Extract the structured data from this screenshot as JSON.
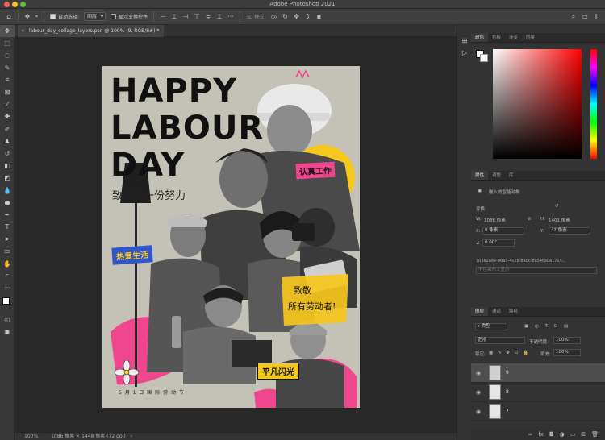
{
  "app": {
    "title": "Adobe Photoshop 2021"
  },
  "options_bar": {
    "auto_select_label": "自动选择:",
    "auto_select_value": "图层",
    "show_transform_label": "显示变换控件",
    "mode_3d_label": "3D 模式:"
  },
  "document": {
    "tab_title": "labour_day_collage_layers.psd @ 100% (9, RGB/8#) *",
    "close_glyph": "×"
  },
  "status_bar": {
    "zoom": "100%",
    "dimensions": "1086 像素 × 1448 像素 (72 ppi)",
    "arrow": "›"
  },
  "poster": {
    "title_line1": "HAPPY",
    "title_line2": "LABOUR",
    "title_line3": "DAY",
    "subtitle": "致敬每一份努力",
    "tag_hardwork": "认真工作",
    "tag_love_life": "热爱生活",
    "tag_ordinary": "平凡闪光",
    "note_line1": "致敬",
    "note_line2": "所有劳动者!",
    "footer": "5 月 1 日   国 际 劳 动 节",
    "colors": {
      "pink": "#f0468e",
      "yellow": "#f6c71c",
      "blue": "#2f55c8",
      "paper": "#c4c2b6"
    }
  },
  "color_panel": {
    "tabs": [
      "颜色",
      "色板",
      "渐变",
      "图案"
    ],
    "hue_color": "#ff0000"
  },
  "properties_panel": {
    "tabs": [
      "属性",
      "调整",
      "库"
    ],
    "object_type": "嵌入的智能对象",
    "section": "变换",
    "w_label": "W:",
    "w_value": "1086 像素",
    "h_label": "H:",
    "h_value": "1401 像素",
    "x_label": "X:",
    "x_value": "0 像素",
    "y_label": "Y:",
    "y_value": "47 像素",
    "angle_value": "0.00°",
    "link_id": "703e2a6e-08a5-4c2b-8a0c-8a54ca0a1725...",
    "layer_comp": "不在画布上显示"
  },
  "layers_panel": {
    "tabs": [
      "图层",
      "通道",
      "路径"
    ],
    "kind_filter": "类型",
    "blend_mode": "正常",
    "opacity_label": "不透明度:",
    "opacity_value": "100%",
    "lock_label": "锁定:",
    "fill_label": "填充:",
    "fill_value": "100%",
    "layers": [
      {
        "name": "9"
      },
      {
        "name": "8"
      },
      {
        "name": "7"
      }
    ]
  },
  "icons": {
    "home": "⌂",
    "move": "✥",
    "search": "⌕",
    "workspace": "▭",
    "share": "⇪"
  }
}
